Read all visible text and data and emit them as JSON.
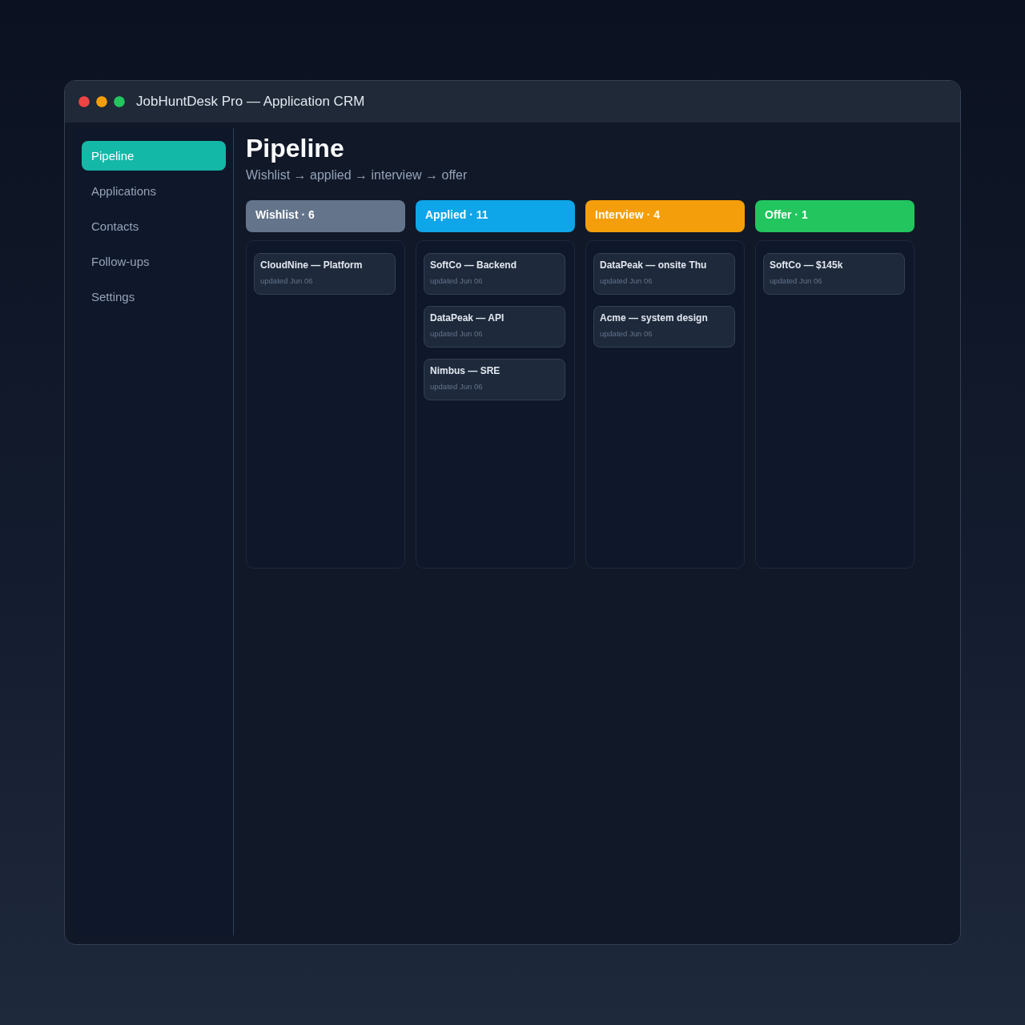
{
  "window": {
    "title": "JobHuntDesk Pro — Application CRM"
  },
  "sidebar": {
    "items": [
      {
        "label": "Pipeline",
        "selected": true
      },
      {
        "label": "Applications",
        "selected": false
      },
      {
        "label": "Contacts",
        "selected": false
      },
      {
        "label": "Follow-ups",
        "selected": false
      },
      {
        "label": "Settings",
        "selected": false
      }
    ]
  },
  "main": {
    "heading": "Pipeline",
    "subtitle": "Wishlist → applied → interview → offer"
  },
  "columns": [
    {
      "title": "Wishlist · 6",
      "color": "#64748b",
      "cards": [
        {
          "title": "CloudNine — Platform",
          "meta": "updated Jun 06"
        }
      ]
    },
    {
      "title": "Applied · 11",
      "color": "#0ea5e9",
      "cards": [
        {
          "title": "SoftCo — Backend",
          "meta": "updated Jun 06"
        },
        {
          "title": "DataPeak — API",
          "meta": "updated Jun 06"
        },
        {
          "title": "Nimbus — SRE",
          "meta": "updated Jun 06"
        }
      ]
    },
    {
      "title": "Interview · 4",
      "color": "#f59e0b",
      "cards": [
        {
          "title": "DataPeak — onsite Thu",
          "meta": "updated Jun 06"
        },
        {
          "title": "Acme — system design",
          "meta": "updated Jun 06"
        }
      ]
    },
    {
      "title": "Offer · 1",
      "color": "#22c55e",
      "cards": [
        {
          "title": "SoftCo — $145k",
          "meta": "updated Jun 06"
        }
      ]
    }
  ]
}
